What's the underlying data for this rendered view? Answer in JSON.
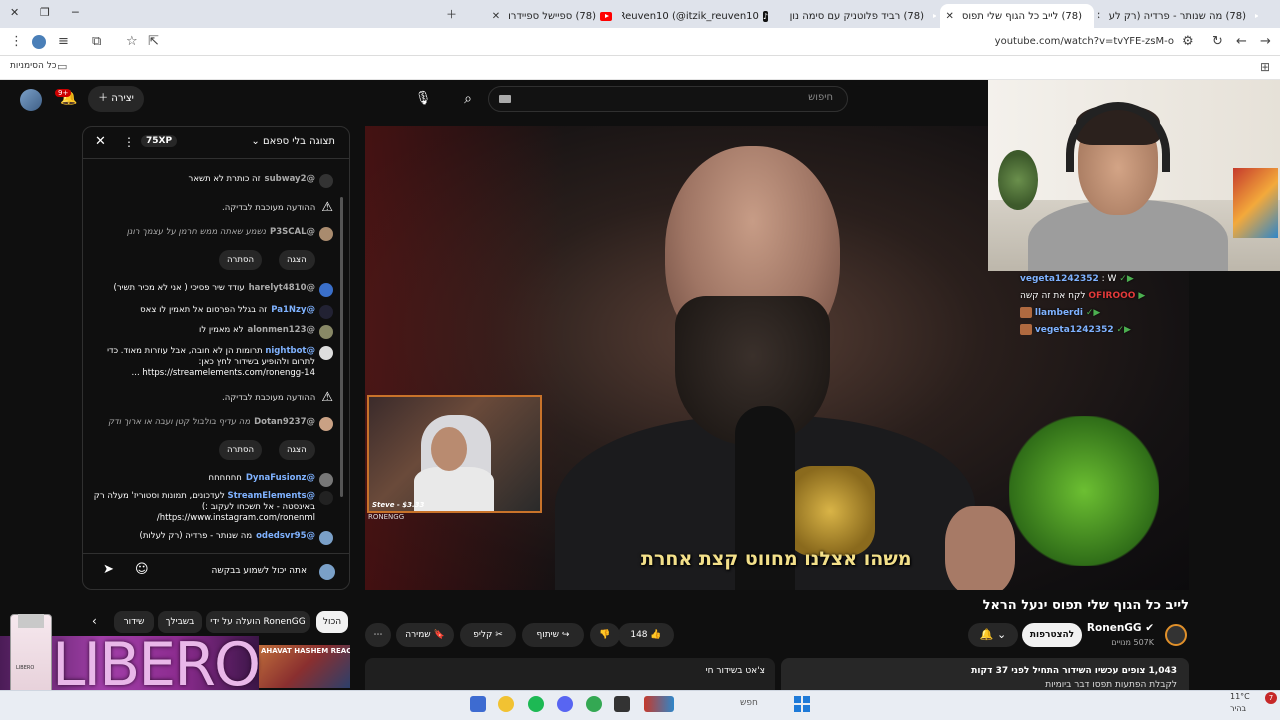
{
  "browser": {
    "tabs": [
      {
        "label": "(78) מה שנותר - פרדיה (רק לע",
        "icon": "youtube-favicon"
      },
      {
        "label": "(78) לייב כל הגוף שלי תפוס",
        "icon": "youtube-favicon",
        "active": true
      },
      {
        "label": "(78) רביד פלוטניק עם סימה נון",
        "icon": "youtube-favicon"
      },
      {
        "label": "ItzikReuven10 (@itzik_reuven10",
        "icon": "tiktok-favicon"
      },
      {
        "label": "(78) ספיישל ספיידרו",
        "icon": "youtube-favicon"
      }
    ],
    "url": "youtube.com/watch?v=tvYFE-zsM-o",
    "bookmarks_label": "כל הסימניות"
  },
  "youtube": {
    "search_placeholder": "חיפוש",
    "create_label": "יצירה",
    "notif_badge": "9+"
  },
  "chat": {
    "mode_label": "תצוגה בלי ספאם",
    "xp_badge": "75XP",
    "messages": [
      {
        "author": "@subway2",
        "text": "זה כותרת לא תשאר"
      },
      {
        "warning": "ההודעה מעוכבת לבדיקה."
      },
      {
        "author": "@P3SCAL",
        "text": "נשמע שאתה ממש חרמן על עצמך רונן",
        "dim": true
      },
      {
        "author": "@harelyt4810",
        "text": "עודד שיר פסיכי ( אני לא מכיר תשיר)"
      },
      {
        "author": "@Pa1Nzy",
        "text": "זה בגלל הפרסום אל תאמין לו צאס"
      },
      {
        "author": "@alonmen123",
        "text": "לא מאמין לו"
      },
      {
        "author": "@nightbot",
        "text": "תרומות הן לא חובה, אבל עוזרות מאוד. כדי לתרום ולהופיע בשידור לחץ כאן: https://streamelements.com/ronengg-14 ..."
      },
      {
        "warning": "ההודעה מעוכבת לבדיקה."
      },
      {
        "author": "@Dotan9237",
        "text": "מה עדיף בולבול קטן ועבה או ארוך ודק",
        "dim": true
      },
      {
        "author": "@DynaFusionz",
        "text": "חחחחחח"
      },
      {
        "author": "@StreamElements",
        "text": "לעדכונים, תמונות וסטוריז' מעלה רק באינסטה - אל תשכחו לעקוב :) https://www.instagram.com/ronenml/"
      },
      {
        "author": "@odedsvr95",
        "text": "מה שנותר - פרדיה (רק לעלות)"
      }
    ],
    "show_label": "הצגה",
    "hide_label": "הסתרה",
    "input_value": "אתה יכול לשמוע בבקשה"
  },
  "video": {
    "subtitle": "משהו אצלנו מחווט קצת אחרת",
    "pip_label": "Steve - $3.33",
    "pip_logo": "RONENGG",
    "overlay_chat": [
      {
        "name": "vegeta1242352",
        "text": ": W"
      },
      {
        "name": "OFIROOO",
        "text": "לקח את זה קשה",
        "red": true
      },
      {
        "name": "llamberdi",
        "text": ""
      },
      {
        "name": "vegeta1242352",
        "text": ""
      }
    ],
    "title": "לייב כל הגוף שלי תפוס ינעל הראל",
    "channel_name": "RonenGG",
    "channel_subs": "507K מנויים",
    "subscribe_label": "להצטרפות",
    "like_count": "148",
    "share_label": "שיתוף",
    "clip_label": "קליפ",
    "save_label": "שמירה",
    "stats_line": "1,043 צופים עכשיו  השידור התחיל לפני 37 דקות",
    "desc_line": "לקבלת הפתעות תפסו דבר ביומיות",
    "live_chat_box": "צ'אט בשידור חי"
  },
  "filters": {
    "chips": [
      "הכול",
      "הועלה על ידי RonenGG",
      "בשבילך",
      "שידור"
    ],
    "rec_thumb_label": "AHAVAT HASHEM REACTS"
  },
  "ad": {
    "brand": "LIBERO",
    "bottle_label": "LIBERO"
  },
  "taskbar": {
    "search_label": "חפש",
    "weather_temp": "11°C",
    "weather_desc": "בהיר",
    "notif_count": "7"
  }
}
